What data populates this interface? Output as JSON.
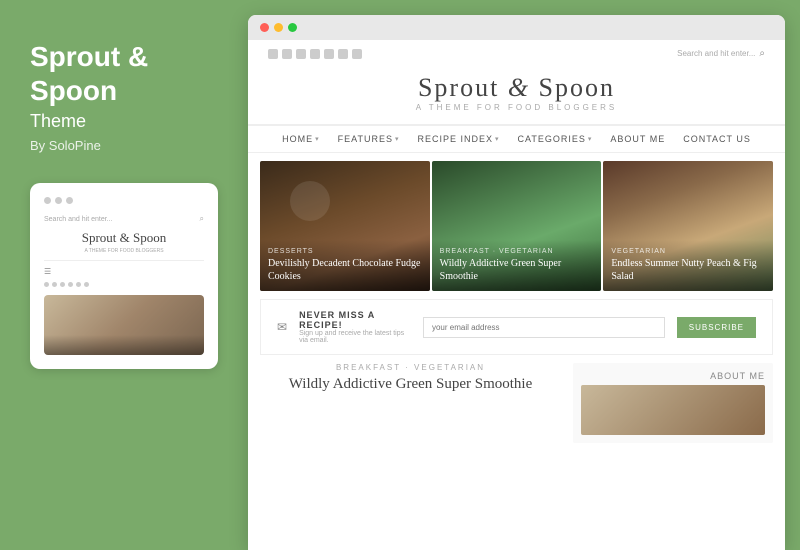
{
  "leftPanel": {
    "title": "Sprout &",
    "title2": "Spoon",
    "subtitle": "Theme",
    "by": "By SoloPine"
  },
  "mobilePreview": {
    "searchPlaceholder": "Search and hit enter...",
    "logoText": "Sprout & Spoon",
    "logoTagline": "A THEME FOR FOOD BLOGGERS"
  },
  "browser": {
    "site": {
      "searchPlaceholder": "Search and hit enter...",
      "logoText": "Sprout & Spoon",
      "logoTagline": "A THEME for FOOD BLOGGERS",
      "nav": [
        {
          "label": "HOME",
          "hasDropdown": true
        },
        {
          "label": "FEATURES",
          "hasDropdown": true
        },
        {
          "label": "RECIPE INDEX",
          "hasDropdown": true
        },
        {
          "label": "CATEGORIES",
          "hasDropdown": true
        },
        {
          "label": "ABOUT ME",
          "hasDropdown": false
        },
        {
          "label": "CONTACT US",
          "hasDropdown": false
        }
      ],
      "featuredCards": [
        {
          "category": "DESSERTS",
          "title": "Devilishly Decadent Chocolate Fudge Cookies"
        },
        {
          "category": "BREAKFAST · VEGETARIAN",
          "title": "Wildly Addictive Green Super Smoothie"
        },
        {
          "category": "VEGETARIAN",
          "title": "Endless Summer Nutty Peach & Fig Salad"
        }
      ],
      "subscribe": {
        "icon": "✉",
        "title": "NEVER MISS A RECIPE!",
        "subtitle": "Sign up and receive the latest tips via email.",
        "inputPlaceholder": "your email address",
        "buttonLabel": "SUBSCRIBE"
      },
      "featuredPost": {
        "category": "BREAKFAST · VEGETARIAN",
        "title": "Wildly Addictive Green Super Smoothie"
      },
      "aboutMe": {
        "title": "ABOUT ME"
      }
    }
  }
}
